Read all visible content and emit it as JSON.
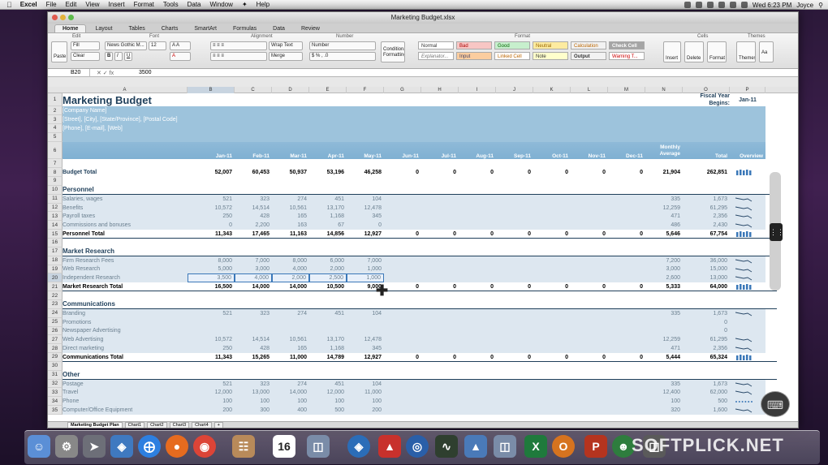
{
  "menubar": {
    "app": "Excel",
    "items": [
      "File",
      "Edit",
      "View",
      "Insert",
      "Format",
      "Tools",
      "Data",
      "Window",
      "Help"
    ],
    "clock": "Wed 6:23 PM",
    "user": "Joyce"
  },
  "window": {
    "title": "Marketing Budget.xlsx",
    "tabs": [
      "Home",
      "Layout",
      "Tables",
      "Charts",
      "SmartArt",
      "Formulas",
      "Data",
      "Review"
    ],
    "active_tab": "Home"
  },
  "ribbon": {
    "groups": [
      "Edit",
      "Font",
      "Alignment",
      "Number",
      "Format",
      "Cells",
      "Themes"
    ],
    "paste": "Paste",
    "fill": "Fill",
    "clear": "Clear",
    "font_name": "News Gothic M...",
    "font_size": "12",
    "wrap_text": "Wrap Text",
    "merge": "Merge",
    "number_format": "Number",
    "conditional": "Conditional Formatting",
    "styles": [
      "Normal",
      "Bad",
      "Good",
      "Neutral",
      "Calculation",
      "Check Cell",
      "Explanator...",
      "Input",
      "Linked Cell",
      "Note",
      "Output",
      "Warning T..."
    ],
    "cells_buttons": [
      "Insert",
      "Delete",
      "Format"
    ],
    "themes_buttons": [
      "Themes",
      "Aa"
    ]
  },
  "formula_bar": {
    "name_box": "B20",
    "value": "3500"
  },
  "columns": [
    "A",
    "B",
    "C",
    "D",
    "E",
    "F",
    "G",
    "H",
    "I",
    "J",
    "K",
    "L",
    "M",
    "N",
    "O",
    "P"
  ],
  "sheet": {
    "title": "Marketing Budget",
    "fiscal_label": "Fiscal Year Begins:",
    "fiscal_value": "Jan-11",
    "company_lines": [
      "[Company Name]",
      "[Street], [City], [State/Province], [Postal Code]",
      "[Phone], [E-mail], [Web]"
    ],
    "months": [
      "Jan-11",
      "Feb-11",
      "Mar-11",
      "Apr-11",
      "May-11",
      "Jun-11",
      "Jul-11",
      "Aug-11",
      "Sep-11",
      "Oct-11",
      "Nov-11",
      "Dec-11"
    ],
    "monthly_avg": "Monthly Average",
    "total_label": "Total",
    "overview_label": "Overview",
    "rows": [
      {
        "n": "8",
        "label": "Budget Total",
        "cls": "bold",
        "vals": [
          "52,007",
          "60,453",
          "50,937",
          "53,196",
          "46,258",
          "0",
          "0",
          "0",
          "0",
          "0",
          "0",
          "0"
        ],
        "avg": "21,904",
        "total": "262,851",
        "spark": "bars"
      },
      {
        "n": "10",
        "label": "Personnel",
        "cls": "section"
      },
      {
        "n": "11",
        "label": "Salaries, wages",
        "cls": "item",
        "vals": [
          "521",
          "323",
          "274",
          "451",
          "104"
        ],
        "avg": "335",
        "total": "1,673",
        "spark": "line"
      },
      {
        "n": "12",
        "label": "Benefits",
        "cls": "item",
        "vals": [
          "10,572",
          "14,514",
          "10,561",
          "13,170",
          "12,478"
        ],
        "avg": "12,259",
        "total": "61,295",
        "spark": "line"
      },
      {
        "n": "13",
        "label": "Payroll taxes",
        "cls": "item",
        "vals": [
          "250",
          "428",
          "165",
          "1,168",
          "345"
        ],
        "avg": "471",
        "total": "2,356",
        "spark": "line"
      },
      {
        "n": "14",
        "label": "Commissions and bonuses",
        "cls": "item",
        "vals": [
          "0",
          "2,200",
          "163",
          "67",
          "0"
        ],
        "avg": "486",
        "total": "2,430",
        "spark": "line"
      },
      {
        "n": "15",
        "label": "Personnel Total",
        "cls": "total",
        "vals": [
          "11,343",
          "17,465",
          "11,163",
          "14,856",
          "12,927",
          "0",
          "0",
          "0",
          "0",
          "0",
          "0",
          "0"
        ],
        "avg": "5,646",
        "total": "67,754",
        "spark": "bars"
      },
      {
        "n": "17",
        "label": "Market Research",
        "cls": "section"
      },
      {
        "n": "18",
        "label": "Firm Research Fees",
        "cls": "item",
        "vals": [
          "8,000",
          "7,000",
          "8,000",
          "6,000",
          "7,000"
        ],
        "avg": "7,200",
        "total": "36,000",
        "spark": "line"
      },
      {
        "n": "19",
        "label": "Web Research",
        "cls": "item",
        "vals": [
          "5,000",
          "3,000",
          "4,000",
          "2,000",
          "1,000"
        ],
        "avg": "3,000",
        "total": "15,000",
        "spark": "line"
      },
      {
        "n": "20",
        "label": "Independent Research",
        "cls": "item",
        "vals": [
          "3,500",
          "4,000",
          "2,000",
          "2,500",
          "1,000"
        ],
        "avg": "2,600",
        "total": "13,000",
        "spark": "line"
      },
      {
        "n": "21",
        "label": "Market Research Total",
        "cls": "total",
        "vals": [
          "16,500",
          "14,000",
          "14,000",
          "10,500",
          "9,000",
          "0",
          "0",
          "0",
          "0",
          "0",
          "0",
          "0"
        ],
        "avg": "5,333",
        "total": "64,000",
        "spark": "bars"
      },
      {
        "n": "23",
        "label": "Communications",
        "cls": "section"
      },
      {
        "n": "24",
        "label": "Branding",
        "cls": "item",
        "vals": [
          "521",
          "323",
          "274",
          "451",
          "104"
        ],
        "avg": "335",
        "total": "1,673",
        "spark": "line"
      },
      {
        "n": "25",
        "label": "Promotions",
        "cls": "item",
        "vals": [],
        "avg": "",
        "total": "0",
        "spark": "none"
      },
      {
        "n": "26",
        "label": "Newspaper Advertising",
        "cls": "item",
        "vals": [],
        "avg": "",
        "total": "0",
        "spark": "none"
      },
      {
        "n": "27",
        "label": "Web Advertising",
        "cls": "item",
        "vals": [
          "10,572",
          "14,514",
          "10,561",
          "13,170",
          "12,478"
        ],
        "avg": "12,259",
        "total": "61,295",
        "spark": "line"
      },
      {
        "n": "28",
        "label": "Direct marketing",
        "cls": "item",
        "vals": [
          "250",
          "428",
          "165",
          "1,168",
          "345"
        ],
        "avg": "471",
        "total": "2,356",
        "spark": "line"
      },
      {
        "n": "29",
        "label": "Communications Total",
        "cls": "total",
        "vals": [
          "11,343",
          "15,265",
          "11,000",
          "14,789",
          "12,927",
          "0",
          "0",
          "0",
          "0",
          "0",
          "0",
          "0"
        ],
        "avg": "5,444",
        "total": "65,324",
        "spark": "bars"
      },
      {
        "n": "31",
        "label": "Other",
        "cls": "section"
      },
      {
        "n": "32",
        "label": "Postage",
        "cls": "item",
        "vals": [
          "521",
          "323",
          "274",
          "451",
          "104"
        ],
        "avg": "335",
        "total": "1,673",
        "spark": "line"
      },
      {
        "n": "33",
        "label": "Travel",
        "cls": "item",
        "vals": [
          "12,000",
          "13,000",
          "14,000",
          "12,000",
          "11,000"
        ],
        "avg": "12,400",
        "total": "62,000",
        "spark": "line"
      },
      {
        "n": "34",
        "label": "Phone",
        "cls": "item",
        "vals": [
          "100",
          "100",
          "100",
          "100",
          "100"
        ],
        "avg": "100",
        "total": "500",
        "spark": "dots"
      },
      {
        "n": "35",
        "label": "Computer/Office Equipment",
        "cls": "item",
        "vals": [
          "200",
          "300",
          "400",
          "500",
          "200"
        ],
        "avg": "320",
        "total": "1,600",
        "spark": "line"
      }
    ]
  },
  "sheet_tabs": [
    "Marketing Budget Plan",
    "Chart1",
    "Chart2",
    "Chart3",
    "Chart4",
    "+"
  ],
  "dock": {
    "calendar_day": "16",
    "watermark": "SOFTPLICK.NET"
  }
}
